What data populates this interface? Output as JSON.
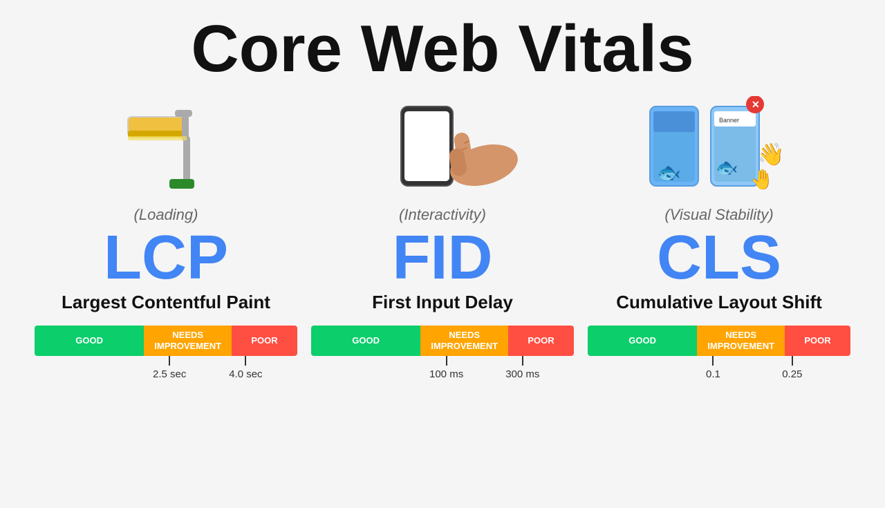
{
  "page": {
    "title": "Core Web Vitals",
    "background": "#f5f5f5"
  },
  "vitals": [
    {
      "id": "lcp",
      "acronym": "LCP",
      "name": "Largest Contentful Paint",
      "category": "(Loading)",
      "icon": "paint-roller",
      "scale": {
        "good_label": "GOOD",
        "needs_label": "NEEDS IMPROVEMENT",
        "poor_label": "POOR",
        "threshold1": "2.5 sec",
        "threshold2": "4.0 sec"
      }
    },
    {
      "id": "fid",
      "acronym": "FID",
      "name": "First Input Delay",
      "category": "(Interactivity)",
      "icon": "phone-tap",
      "scale": {
        "good_label": "GOOD",
        "needs_label": "NEEDS IMPROVEMENT",
        "poor_label": "POOR",
        "threshold1": "100 ms",
        "threshold2": "300 ms"
      }
    },
    {
      "id": "cls",
      "acronym": "CLS",
      "name": "Cumulative Layout Shift",
      "category": "(Visual Stability)",
      "icon": "layout-shift",
      "scale": {
        "good_label": "GOOD",
        "needs_label": "NEEDS IMPROVEMENT",
        "poor_label": "POOR",
        "threshold1": "0.1",
        "threshold2": "0.25"
      }
    }
  ]
}
